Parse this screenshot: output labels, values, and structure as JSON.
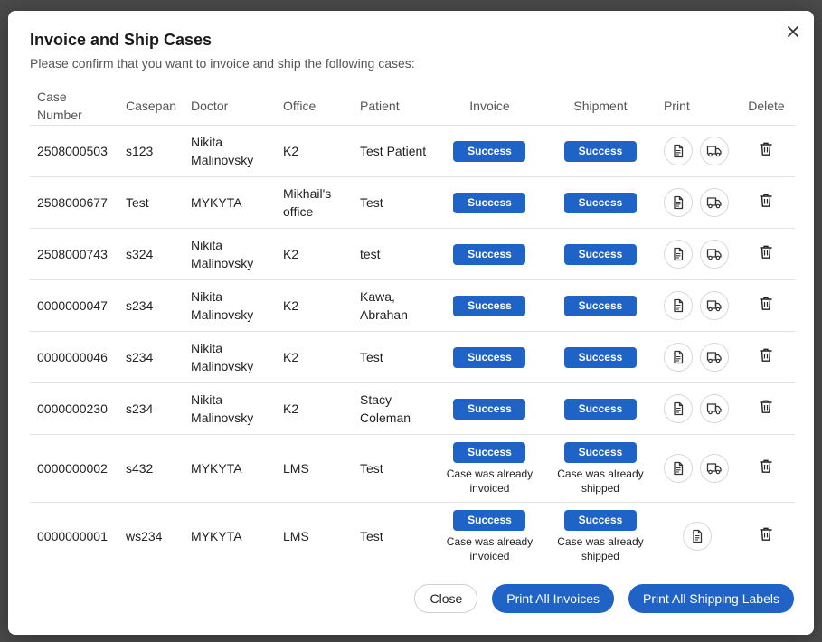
{
  "dialog": {
    "title": "Invoice and Ship Cases",
    "subtitle": "Please confirm that you want to invoice and ship the following cases:"
  },
  "table": {
    "headers": {
      "case_number": "Case Number",
      "casepan": "Casepan",
      "doctor": "Doctor",
      "office": "Office",
      "patient": "Patient",
      "invoice": "Invoice",
      "shipment": "Shipment",
      "print": "Print",
      "delete": "Delete"
    },
    "rows": [
      {
        "case_number": "2508000503",
        "casepan": "s123",
        "doctor": "Nikita Malinovsky",
        "office": "K2",
        "patient": "Test Patient",
        "invoice": "Success",
        "invoice_note": "",
        "shipment": "Success",
        "shipment_note": "",
        "print_icons": [
          "document-icon",
          "truck-icon"
        ]
      },
      {
        "case_number": "2508000677",
        "casepan": "Test",
        "doctor": "MYKYTA",
        "office": "Mikhail's office",
        "patient": "Test",
        "invoice": "Success",
        "invoice_note": "",
        "shipment": "Success",
        "shipment_note": "",
        "print_icons": [
          "document-icon",
          "truck-icon"
        ]
      },
      {
        "case_number": "2508000743",
        "casepan": "s324",
        "doctor": "Nikita Malinovsky",
        "office": "K2",
        "patient": "test",
        "invoice": "Success",
        "invoice_note": "",
        "shipment": "Success",
        "shipment_note": "",
        "print_icons": [
          "document-icon",
          "truck-icon"
        ]
      },
      {
        "case_number": "0000000047",
        "casepan": "s234",
        "doctor": "Nikita Malinovsky",
        "office": "K2",
        "patient": "Kawa, Abrahan",
        "invoice": "Success",
        "invoice_note": "",
        "shipment": "Success",
        "shipment_note": "",
        "print_icons": [
          "document-icon",
          "truck-icon"
        ]
      },
      {
        "case_number": "0000000046",
        "casepan": "s234",
        "doctor": "Nikita Malinovsky",
        "office": "K2",
        "patient": "Test",
        "invoice": "Success",
        "invoice_note": "",
        "shipment": "Success",
        "shipment_note": "",
        "print_icons": [
          "document-icon",
          "truck-icon"
        ]
      },
      {
        "case_number": "0000000230",
        "casepan": "s234",
        "doctor": "Nikita Malinovsky",
        "office": "K2",
        "patient": "Stacy Coleman",
        "invoice": "Success",
        "invoice_note": "",
        "shipment": "Success",
        "shipment_note": "",
        "print_icons": [
          "document-icon",
          "truck-icon"
        ]
      },
      {
        "case_number": "0000000002",
        "casepan": "s432",
        "doctor": "MYKYTA",
        "office": "LMS",
        "patient": "Test",
        "invoice": "Success",
        "invoice_note": "Case was already invoiced",
        "shipment": "Success",
        "shipment_note": "Case was already shipped",
        "print_icons": [
          "document-icon",
          "truck-icon"
        ]
      },
      {
        "case_number": "0000000001",
        "casepan": "ws234",
        "doctor": "MYKYTA",
        "office": "LMS",
        "patient": "Test",
        "invoice": "Success",
        "invoice_note": "Case was already invoiced",
        "shipment": "Success",
        "shipment_note": "Case was already shipped",
        "print_icons": [
          "document-icon"
        ]
      }
    ]
  },
  "footer": {
    "close_label": "Close",
    "print_invoices_label": "Print All Invoices",
    "print_labels_label": "Print All Shipping Labels"
  },
  "colors": {
    "accent": "#1f63c6",
    "badge_text": "#ffffff",
    "overlay": "#4a4a4a"
  },
  "icons": {
    "close": "close-icon",
    "document": "document-icon",
    "truck": "truck-icon",
    "delete": "trash-icon"
  }
}
